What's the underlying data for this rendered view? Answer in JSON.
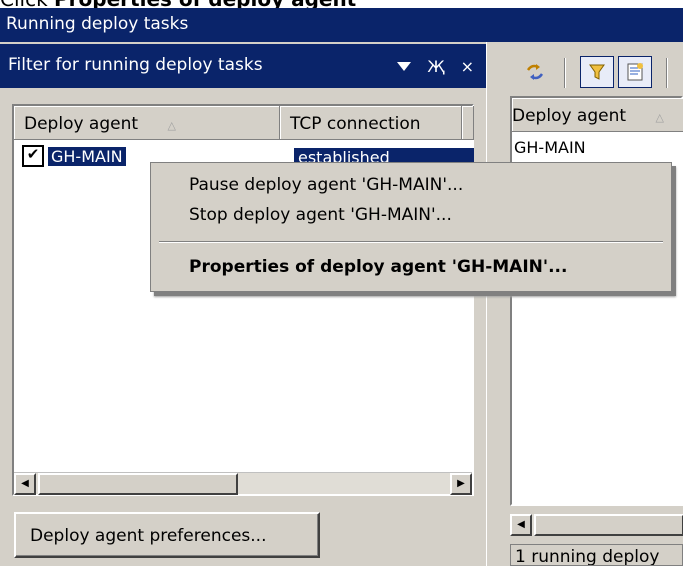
{
  "instruction": {
    "prefix": "Click ",
    "target": "Properties of deploy agent"
  },
  "window": {
    "title": "Running deploy tasks"
  },
  "filter_panel": {
    "title": "Filter for running deploy tasks",
    "controls": {
      "dropdown_icon": "dropdown-arrow-icon",
      "pin_symbol": "Җ",
      "close_symbol": "×"
    }
  },
  "agent_list": {
    "columns": [
      "Deploy agent",
      "TCP connection"
    ],
    "sort_indicator": "△",
    "rows": [
      {
        "checked": true,
        "check_symbol": "✔",
        "agent": "GH-MAIN",
        "tcp": "established"
      }
    ]
  },
  "preferences_button": {
    "label": "Deploy agent preferences..."
  },
  "right_panel": {
    "column": "Deploy agent",
    "sort_indicator": "△",
    "rows": [
      "GH-MAIN"
    ],
    "status": "1 running deploy"
  },
  "context_menu": {
    "items": [
      {
        "label": "Pause deploy agent 'GH-MAIN'..."
      },
      {
        "label": "Stop deploy agent 'GH-MAIN'..."
      },
      {
        "label": "Properties of deploy agent 'GH-MAIN'...",
        "bold": true
      }
    ]
  },
  "colors": {
    "title_bar": "#0a246a",
    "panel_bg": "#d4d0c8",
    "selection": "#0a246a"
  }
}
